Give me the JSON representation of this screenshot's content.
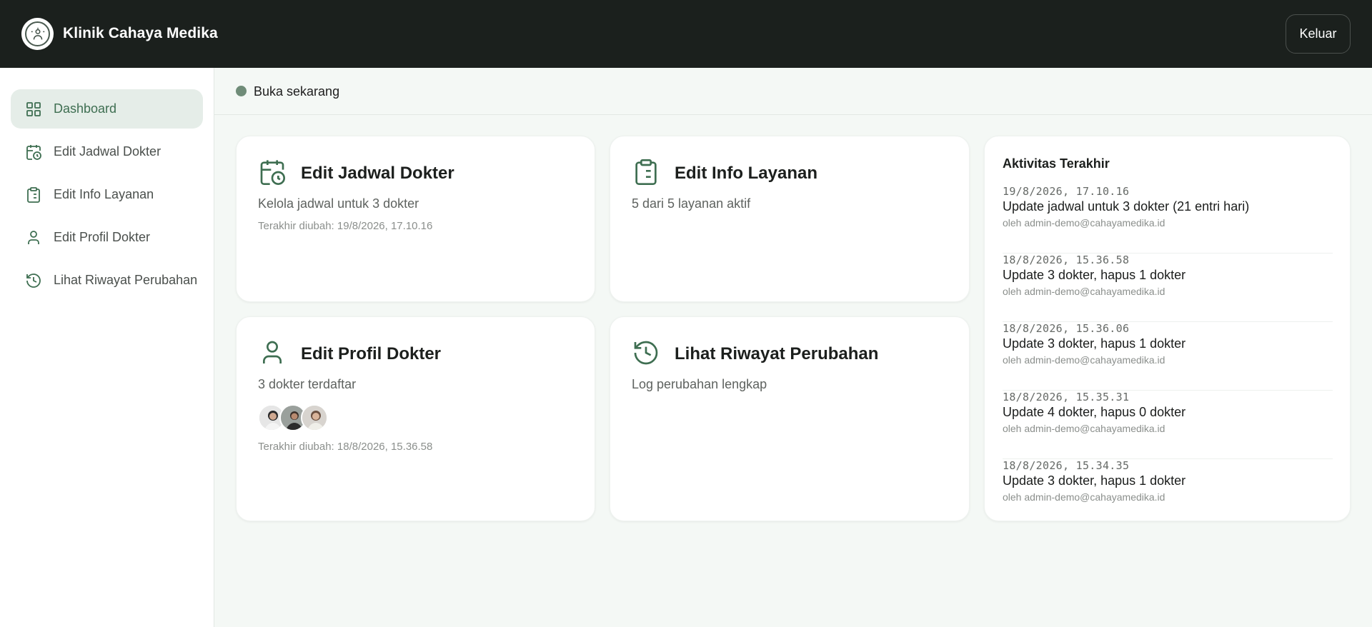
{
  "header": {
    "brand": "Klinik Cahaya Medika",
    "logout_label": "Keluar"
  },
  "sidebar": {
    "items": [
      {
        "label": "Dashboard",
        "icon": "grid-icon",
        "active": true
      },
      {
        "label": "Edit Jadwal Dokter",
        "icon": "calendar-clock-icon"
      },
      {
        "label": "Edit Info Layanan",
        "icon": "clipboard-list-icon"
      },
      {
        "label": "Edit Profil Dokter",
        "icon": "user-icon"
      },
      {
        "label": "Lihat Riwayat Perubahan",
        "icon": "history-icon"
      }
    ]
  },
  "status": {
    "text": "Buka sekarang",
    "color": "#6f8c78"
  },
  "cards": {
    "jadwal": {
      "title": "Edit Jadwal Dokter",
      "subtitle": "Kelola jadwal untuk 3 dokter",
      "meta": "Terakhir diubah: 19/8/2026, 17.10.16"
    },
    "layanan": {
      "title": "Edit Info Layanan",
      "subtitle": "5 dari 5 layanan aktif"
    },
    "profil": {
      "title": "Edit Profil Dokter",
      "subtitle": "3 dokter terdaftar",
      "meta": "Terakhir diubah: 18/8/2026, 15.36.58"
    },
    "riwayat": {
      "title": "Lihat Riwayat Perubahan",
      "subtitle": "Log perubahan lengkap"
    }
  },
  "activity": {
    "title": "Aktivitas Terakhir",
    "items": [
      {
        "time": "19/8/2026, 17.10.16",
        "text": "Update jadwal untuk 3 dokter (21 entri hari)",
        "user": "oleh admin-demo@cahayamedika.id"
      },
      {
        "time": "18/8/2026, 15.36.58",
        "text": "Update 3 dokter, hapus 1 dokter",
        "user": "oleh admin-demo@cahayamedika.id"
      },
      {
        "time": "18/8/2026, 15.36.06",
        "text": "Update 3 dokter, hapus 1 dokter",
        "user": "oleh admin-demo@cahayamedika.id"
      },
      {
        "time": "18/8/2026, 15.35.31",
        "text": "Update 4 dokter, hapus 0 dokter",
        "user": "oleh admin-demo@cahayamedika.id"
      },
      {
        "time": "18/8/2026, 15.34.35",
        "text": "Update 3 dokter, hapus 1 dokter",
        "user": "oleh admin-demo@cahayamedika.id"
      }
    ]
  },
  "colors": {
    "accent": "#3e6e51",
    "header_bg": "#1b201d",
    "active_nav_bg": "#e5ede8"
  }
}
